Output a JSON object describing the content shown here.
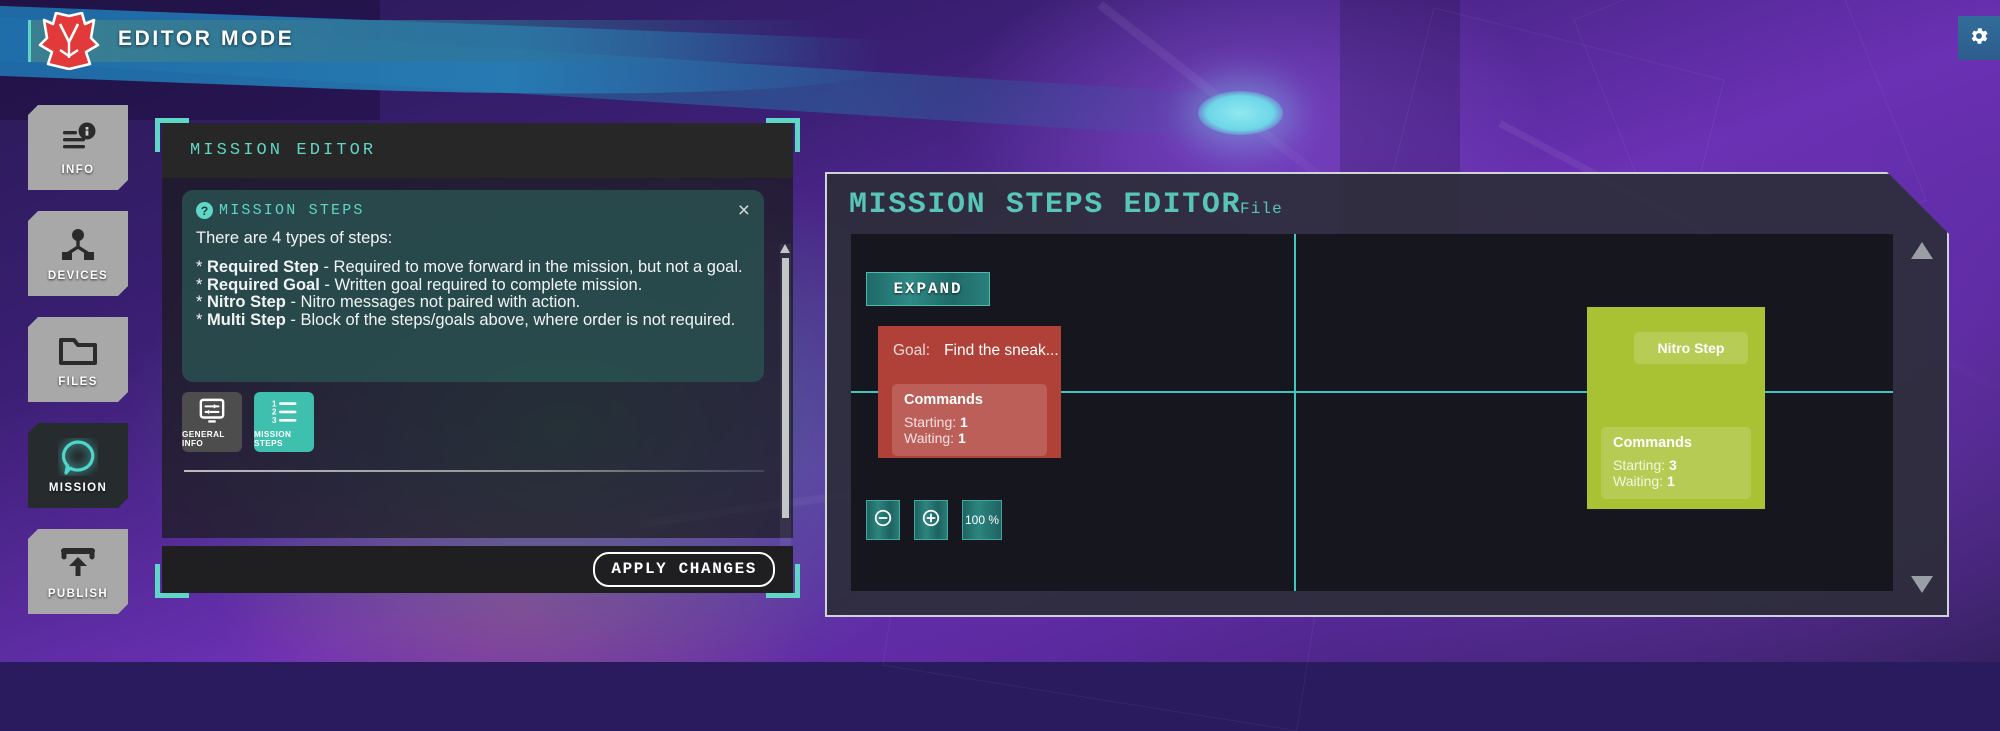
{
  "header": {
    "mode_title": "EDITOR MODE",
    "logo_name": "fox-head-logo",
    "settings_icon": "gear-icon"
  },
  "sidebar": {
    "items": [
      {
        "label": "INFO",
        "icon": "info-lines-icon",
        "active": false
      },
      {
        "label": "DEVICES",
        "icon": "devices-node-icon",
        "active": false
      },
      {
        "label": "FILES",
        "icon": "folder-icon",
        "active": false
      },
      {
        "label": "MISSION",
        "icon": "speech-bubble-icon",
        "active": true
      },
      {
        "label": "PUBLISH",
        "icon": "upload-arrow-icon",
        "active": false
      }
    ]
  },
  "mission_editor": {
    "title": "MISSION EDITOR",
    "help": {
      "icon": "question-mark-icon",
      "title": "MISSION STEPS",
      "close_label": "×",
      "intro": "There are 4 types of steps:",
      "items": [
        {
          "bullet": " * ",
          "name": "Required Step",
          "desc": " - Required to move forward in the mission, but not a goal."
        },
        {
          "bullet": " * ",
          "name": "Required Goal",
          "desc": " - Written goal required to complete mission."
        },
        {
          "bullet": " * ",
          "name": "Nitro Step",
          "desc": " - Nitro messages not paired with action."
        },
        {
          "bullet": " * ",
          "name": "Multi Step",
          "desc": " - Block of the steps/goals above, where order is not required."
        }
      ]
    },
    "tabs": [
      {
        "label": "GENERAL INFO",
        "icon": "general-info-icon",
        "active": false
      },
      {
        "label": "MISSION STEPS",
        "icon": "numbered-list-icon",
        "active": true
      }
    ],
    "apply_button": "APPLY CHANGES"
  },
  "steps_editor": {
    "title": "MISSION STEPS EDITOR",
    "file_label": "File",
    "expand_button": "EXPAND",
    "cards": [
      {
        "type": "required-goal",
        "color": "#b04139",
        "goal_label": "Goal:",
        "goal_value": "Find the sneak...",
        "commands_title": "Commands",
        "starting_label": "Starting:",
        "starting_value": "1",
        "waiting_label": "Waiting:",
        "waiting_value": "1"
      },
      {
        "type": "nitro-step",
        "color": "#a9c233",
        "chip_label": "Nitro Step",
        "commands_title": "Commands",
        "starting_label": "Starting:",
        "starting_value": "3",
        "waiting_label": "Waiting:",
        "waiting_value": "1"
      }
    ],
    "zoom": {
      "out_icon": "zoom-out-icon",
      "in_icon": "zoom-in-icon",
      "level": "100 %"
    },
    "scroll_up_icon": "triangle-up-icon",
    "scroll_down_icon": "triangle-down-icon"
  },
  "colors": {
    "accent_teal": "#5fd6c6",
    "panel_dark": "#272727",
    "goal_red": "#b04139",
    "nitro_green": "#a9c233",
    "title_teal": "#57c6b8"
  }
}
